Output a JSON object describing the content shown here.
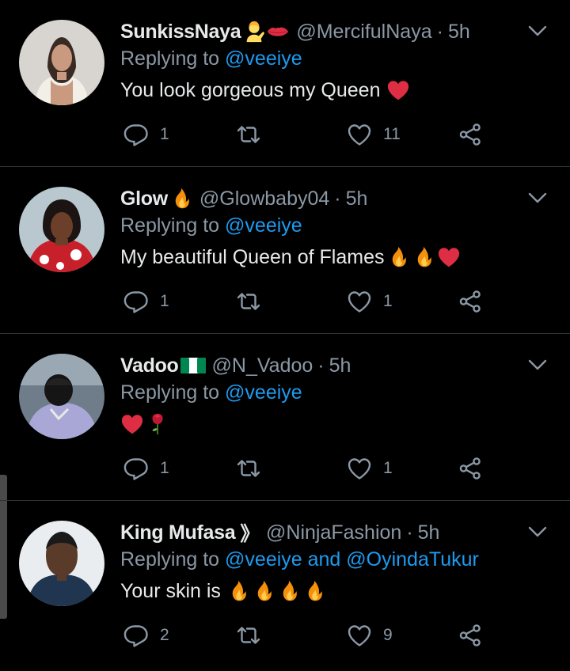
{
  "tweets": [
    {
      "name": "SunkissNaya",
      "name_emojis": [
        "person-tipping-hand-emoji",
        "kiss-mark-emoji"
      ],
      "handle": "@MercifulNaya",
      "separator": "·",
      "time": "5h",
      "replying_prefix": "Replying to ",
      "replying_to": "@veeiye",
      "text": "You look gorgeous my Queen",
      "text_emojis": [
        "red-heart-emoji"
      ],
      "replies": "1",
      "retweets": "",
      "likes": "11"
    },
    {
      "name": "Glow",
      "name_emojis": [
        "fire-emoji"
      ],
      "handle": "@Glowbaby04",
      "separator": "·",
      "time": "5h",
      "replying_prefix": "Replying to ",
      "replying_to": "@veeiye",
      "text": "My beautiful Queen of Flames",
      "text_emojis": [
        "fire-emoji",
        "fire-emoji",
        "red-heart-emoji"
      ],
      "replies": "1",
      "retweets": "",
      "likes": "1"
    },
    {
      "name": "Vadoo",
      "name_emojis": [
        "nigeria-flag-emoji"
      ],
      "handle": "@N_Vadoo",
      "separator": "·",
      "time": "5h",
      "replying_prefix": "Replying to ",
      "replying_to": "@veeiye",
      "text": "",
      "text_emojis": [
        "red-heart-emoji",
        "rose-emoji"
      ],
      "replies": "1",
      "retweets": "",
      "likes": "1"
    },
    {
      "name": "King Mufasa",
      "name_suffix": "》",
      "name_emojis": [],
      "handle": "@NinjaFashion",
      "separator": "·",
      "time": "5h",
      "replying_prefix": "Replying to ",
      "replying_to": "@veeiye and @OyindaTukur",
      "text": "Your skin is ",
      "text_emojis": [
        "fire-emoji",
        "fire-emoji",
        "fire-emoji",
        "fire-emoji"
      ],
      "replies": "2",
      "retweets": "",
      "likes": "9"
    }
  ],
  "colors": {
    "background": "#000000",
    "primary_text": "#e7e9ea",
    "secondary_text": "#8b98a5",
    "link": "#1d9bf0",
    "divider": "#2f3336"
  },
  "icons": {
    "reply": "reply-icon",
    "retweet": "retweet-icon",
    "like": "heart-icon",
    "share": "share-icon",
    "caret": "chevron-down-icon"
  }
}
